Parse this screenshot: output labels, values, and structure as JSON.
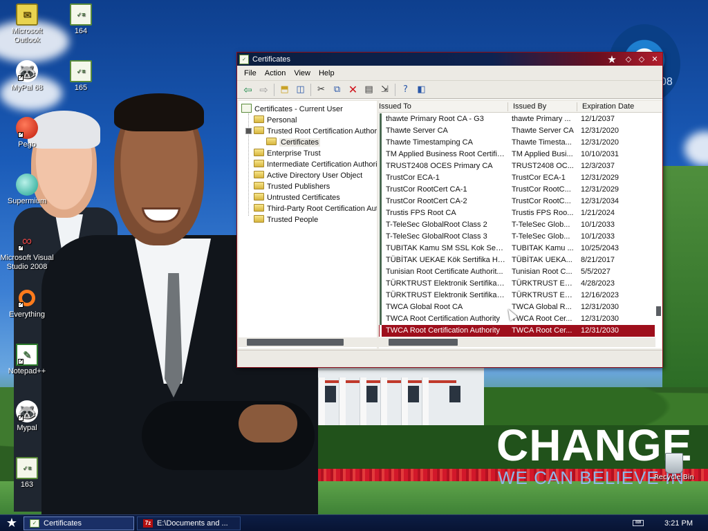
{
  "desktop": {
    "background_headline": "CHANGE",
    "background_subline": "WE CAN BELIEVE IN",
    "seal_text": "08",
    "icons_left": [
      {
        "label": "Microsoft Outlook",
        "icon": "outlook-icon"
      },
      {
        "label": "MyPal 68",
        "icon": "mypal-icon"
      },
      {
        "label": "Pego",
        "icon": "pego-icon"
      },
      {
        "label": "Supermium",
        "icon": "supermium-icon"
      },
      {
        "label": "Microsoft Visual Studio 2008",
        "icon": "visual-studio-icon"
      },
      {
        "label": "Everything",
        "icon": "everything-icon"
      },
      {
        "label": "Notepad++",
        "icon": "notepad-plus-plus-icon"
      },
      {
        "label": "Mypal",
        "icon": "mypal-icon"
      },
      {
        "label": "163",
        "icon": "certificate-file-icon"
      }
    ],
    "icons_right": [
      {
        "label": "164",
        "icon": "certificate-file-icon"
      },
      {
        "label": "165",
        "icon": "certificate-file-icon"
      }
    ],
    "recycle_bin": "Recycle Bin"
  },
  "window": {
    "title": "Certificates",
    "menu": [
      "File",
      "Action",
      "View",
      "Help"
    ],
    "tree": {
      "root": "Certificates - Current User",
      "nodes": [
        "Personal",
        "Trusted Root Certification Authorities",
        "Certificates",
        "Enterprise Trust",
        "Intermediate Certification Authorities",
        "Active Directory User Object",
        "Trusted Publishers",
        "Untrusted Certificates",
        "Third-Party Root Certification Authorities",
        "Trusted People"
      ]
    },
    "columns": {
      "issued_to": "Issued To",
      "issued_by": "Issued By",
      "expiration": "Expiration Date"
    },
    "rows": [
      {
        "to": "thawte Primary Root CA - G3",
        "by": "thawte Primary ...",
        "exp": "12/1/2037"
      },
      {
        "to": "Thawte Server CA",
        "by": "Thawte Server CA",
        "exp": "12/31/2020"
      },
      {
        "to": "Thawte Timestamping CA",
        "by": "Thawte Timesta...",
        "exp": "12/31/2020"
      },
      {
        "to": "TM Applied Business Root Certificate",
        "by": "TM Applied Busi...",
        "exp": "10/10/2031"
      },
      {
        "to": "TRUST2408 OCES Primary CA",
        "by": "TRUST2408 OC...",
        "exp": "12/3/2037"
      },
      {
        "to": "TrustCor ECA-1",
        "by": "TrustCor ECA-1",
        "exp": "12/31/2029"
      },
      {
        "to": "TrustCor RootCert CA-1",
        "by": "TrustCor RootC...",
        "exp": "12/31/2029"
      },
      {
        "to": "TrustCor RootCert CA-2",
        "by": "TrustCor RootC...",
        "exp": "12/31/2034"
      },
      {
        "to": "Trustis FPS Root CA",
        "by": "Trustis FPS Roo...",
        "exp": "1/21/2024"
      },
      {
        "to": "T-TeleSec GlobalRoot Class 2",
        "by": "T-TeleSec Glob...",
        "exp": "10/1/2033"
      },
      {
        "to": "T-TeleSec GlobalRoot Class 3",
        "by": "T-TeleSec Glob...",
        "exp": "10/1/2033"
      },
      {
        "to": "TUBITAK Kamu SM SSL Kok Sertifik...",
        "by": "TUBITAK Kamu ...",
        "exp": "10/25/2043"
      },
      {
        "to": "TÜBİTAK UEKAE Kök Sertifika Hizm...",
        "by": "TÜBİTAK UEKA...",
        "exp": "8/21/2017"
      },
      {
        "to": "Tunisian Root Certificate Authorit...",
        "by": "Tunisian Root C...",
        "exp": "5/5/2027"
      },
      {
        "to": "TÜRKTRUST Elektronik Sertifika Hi...",
        "by": "TÜRKTRUST Ele...",
        "exp": "4/28/2023"
      },
      {
        "to": "TÜRKTRUST Elektronik Sertifika Hi...",
        "by": "TÜRKTRUST Ele...",
        "exp": "12/16/2023"
      },
      {
        "to": "TWCA Global Root CA",
        "by": "TWCA Global R...",
        "exp": "12/31/2030"
      },
      {
        "to": "TWCA Root Certification Authority",
        "by": "TWCA Root Cer...",
        "exp": "12/31/2030"
      },
      {
        "to": "TWCA Root Certification Authority",
        "by": "TWCA Root Cer...",
        "exp": "12/31/2030",
        "selected": true
      }
    ]
  },
  "taskbar": {
    "tasks": [
      {
        "label": "Certificates",
        "active": true
      },
      {
        "label": "E:\\Documents and ...",
        "active": false
      }
    ],
    "clock": "3:21 PM",
    "colors": {
      "taskbar": "#081433",
      "selection": "#9e0f1c",
      "title_accent": "#b11d2c"
    }
  }
}
